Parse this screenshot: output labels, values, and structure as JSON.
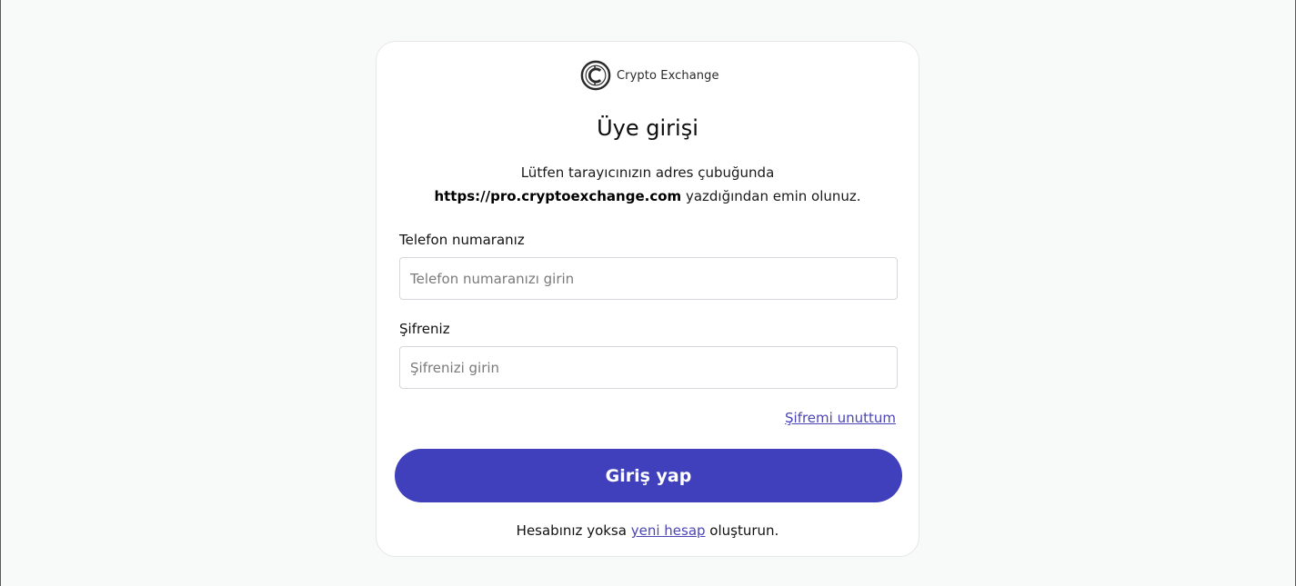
{
  "brand": {
    "icon": "crypto-coin-icon",
    "name": "Crypto Exchange"
  },
  "login": {
    "title": "Üye girişi",
    "notice_line1": "Lütfen tarayıcınızın adres çubuğunda",
    "notice_url": "https://pro.cryptoexchange.com",
    "notice_line2_suffix": " yazdığından emin olunuz."
  },
  "phone": {
    "label": "Telefon numaranız",
    "placeholder": "Telefon numaranızı girin",
    "value": ""
  },
  "password": {
    "label": "Şifreniz",
    "placeholder": "Şifrenizi girin",
    "value": ""
  },
  "forgot_password_link": "Şifremi unuttum",
  "submit_button": "Giriş yap",
  "signup": {
    "prefix": "Hesabınız yoksa ",
    "link": "yeni hesap",
    "suffix": " oluşturun."
  },
  "colors": {
    "primary": "#4040bd",
    "link": "#4b45b8",
    "page_background": "#f8f9f9",
    "card_background": "#ffffff"
  }
}
